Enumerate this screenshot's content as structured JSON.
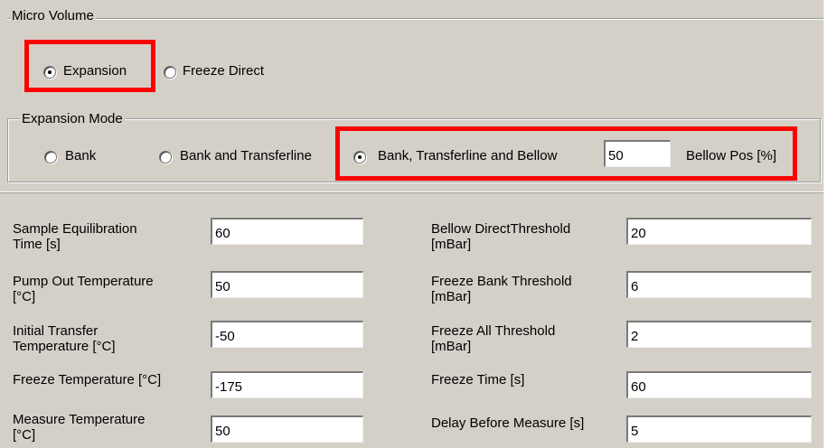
{
  "micro_volume": {
    "title": "Micro Volume",
    "options": [
      {
        "label": "Expansion",
        "checked": true
      },
      {
        "label": "Freeze Direct",
        "checked": false
      }
    ]
  },
  "expansion_mode": {
    "title": "Expansion Mode",
    "options": [
      {
        "label": "Bank",
        "checked": false
      },
      {
        "label": "Bank and Transferline",
        "checked": false
      },
      {
        "label": "Bank, Transferline and Bellow",
        "checked": true
      }
    ],
    "bellow_pos_value": "50",
    "bellow_pos_label": "Bellow Pos [%]"
  },
  "params_left": [
    {
      "label": "Sample Equilibration\nTime [s]",
      "value": "60"
    },
    {
      "label": "Pump Out Temperature\n[°C]",
      "value": "50"
    },
    {
      "label": "Initial Transfer\nTemperature [°C]",
      "value": "-50"
    },
    {
      "label": "Freeze Temperature [°C]",
      "value": "-175"
    },
    {
      "label": "Measure Temperature\n[°C]",
      "value": "50"
    }
  ],
  "params_right": [
    {
      "label": "Bellow DirectThreshold\n[mBar]",
      "value": "20"
    },
    {
      "label": "Freeze Bank Threshold\n[mBar]",
      "value": "6"
    },
    {
      "label": "Freeze All Threshold\n[mBar]",
      "value": "2"
    },
    {
      "label": "Freeze Time [s]",
      "value": "60"
    },
    {
      "label": "Delay Before Measure [s]",
      "value": "5"
    }
  ],
  "colors": {
    "panel": "#d4d0c8",
    "highlight": "#ff0000"
  }
}
